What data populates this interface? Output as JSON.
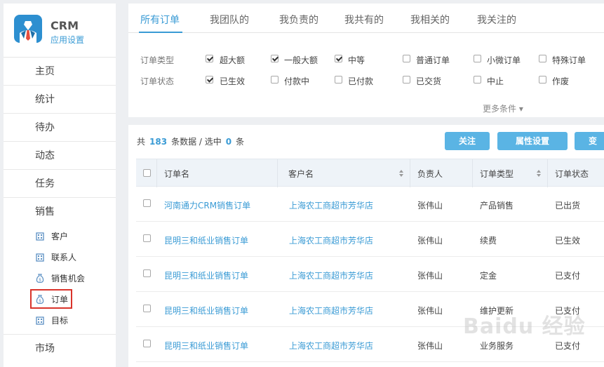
{
  "brand": {
    "title": "CRM",
    "subtitle": "应用设置"
  },
  "sidebar": {
    "items": [
      {
        "label": "主页"
      },
      {
        "label": "统计"
      },
      {
        "label": "待办"
      },
      {
        "label": "动态"
      },
      {
        "label": "任务"
      }
    ],
    "sales_group": "销售",
    "sales_items": [
      {
        "label": "客户",
        "icon": "building-icon"
      },
      {
        "label": "联系人",
        "icon": "building-icon"
      },
      {
        "label": "销售机会",
        "icon": "money-bag-icon"
      },
      {
        "label": "订单",
        "icon": "money-bag-icon"
      },
      {
        "label": "目标",
        "icon": "building-icon"
      }
    ],
    "market": "市场"
  },
  "tabs": [
    {
      "label": "所有订单",
      "active": true
    },
    {
      "label": "我团队的"
    },
    {
      "label": "我负责的"
    },
    {
      "label": "我共有的"
    },
    {
      "label": "我相关的"
    },
    {
      "label": "我关注的"
    }
  ],
  "filters": {
    "type_label": "订单类型",
    "status_label": "订单状态",
    "type_options": [
      {
        "label": "超大额",
        "checked": true
      },
      {
        "label": "一般大额",
        "checked": true
      },
      {
        "label": "中等",
        "checked": true
      },
      {
        "label": "普通订单",
        "checked": false
      },
      {
        "label": "小微订单",
        "checked": false
      },
      {
        "label": "特殊订单",
        "checked": false
      }
    ],
    "status_options": [
      {
        "label": "已生效",
        "checked": true
      },
      {
        "label": "付款中",
        "checked": false
      },
      {
        "label": "已付款",
        "checked": false
      },
      {
        "label": "已交货",
        "checked": false
      },
      {
        "label": "中止",
        "checked": false
      },
      {
        "label": "作废",
        "checked": false
      }
    ],
    "more": "更多条件 ▾"
  },
  "summary": {
    "prefix": "共",
    "total": "183",
    "mid": "条数据  /  选中",
    "selected": "0",
    "suffix": "条"
  },
  "buttons": {
    "follow": "关注",
    "attributes": "属性设置",
    "change": "变更"
  },
  "table": {
    "headers": [
      "订单名",
      "客户名",
      "负责人",
      "订单类型",
      "订单状态"
    ],
    "rows": [
      {
        "order": "河南通力CRM销售订单",
        "customer": "上海农工商超市芳华店",
        "owner": "张伟山",
        "type": "产品销售",
        "status": "已出货"
      },
      {
        "order": "昆明三和纸业销售订单",
        "customer": "上海农工商超市芳华店",
        "owner": "张伟山",
        "type": "续费",
        "status": "已生效"
      },
      {
        "order": "昆明三和纸业销售订单",
        "customer": "上海农工商超市芳华店",
        "owner": "张伟山",
        "type": "定金",
        "status": "已支付"
      },
      {
        "order": "昆明三和纸业销售订单",
        "customer": "上海农工商超市芳华店",
        "owner": "张伟山",
        "type": "维护更新",
        "status": "已支付"
      },
      {
        "order": "昆明三和纸业销售订单",
        "customer": "上海农工商超市芳华店",
        "owner": "张伟山",
        "type": "业务服务",
        "status": "已支付"
      }
    ]
  },
  "watermark": "Baidu 经验",
  "colors": {
    "accent": "#3a9bd5",
    "button": "#5ab4e4",
    "highlight": "#d9342b"
  }
}
